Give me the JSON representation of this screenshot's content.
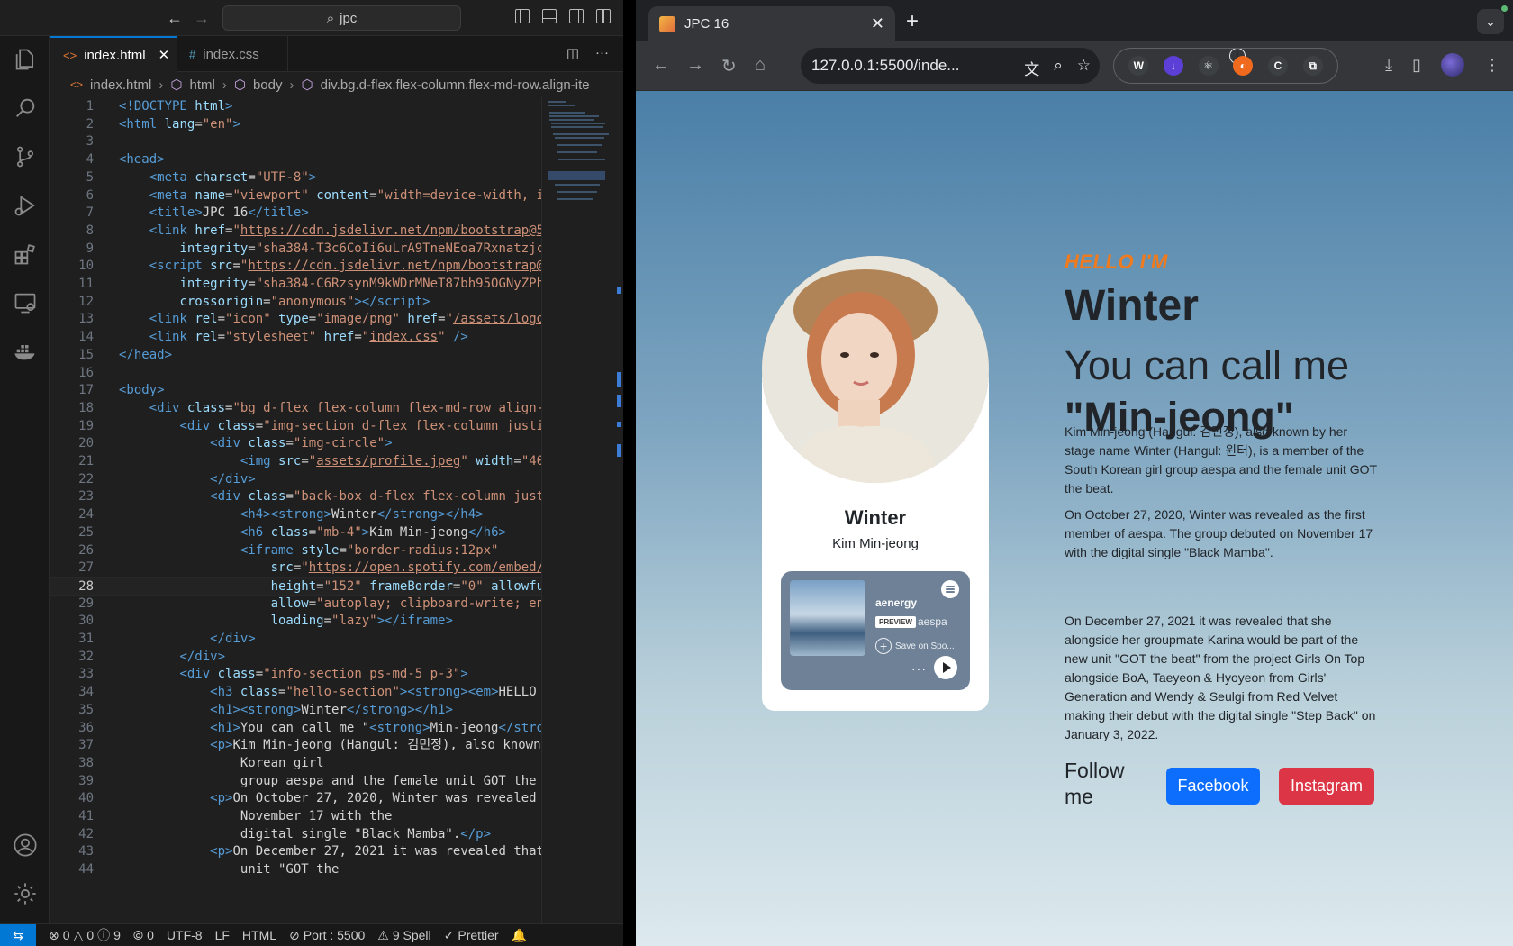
{
  "vscode": {
    "search_text": "jpc",
    "tabs": [
      {
        "icon": "<>",
        "label": "index.html"
      },
      {
        "icon": "#",
        "label": "index.css"
      }
    ],
    "breadcrumb": [
      "index.html",
      "html",
      "body",
      "div.bg.d-flex.flex-column.flex-md-row.align-ite"
    ],
    "lines": [
      {
        "n": "1",
        "html": "<span class='tg'>&lt;!DOCTYPE</span> <span class='at'>html</span><span class='tg'>&gt;</span>"
      },
      {
        "n": "2",
        "html": "<span class='tg'>&lt;html</span> <span class='at'>lang</span>=<span class='st'>\"en\"</span><span class='tg'>&gt;</span>"
      },
      {
        "n": "3",
        "html": ""
      },
      {
        "n": "4",
        "html": "<span class='tg'>&lt;head&gt;</span>"
      },
      {
        "n": "5",
        "html": "    <span class='tg'>&lt;meta</span> <span class='at'>charset</span>=<span class='st'>\"UTF-8\"</span><span class='tg'>&gt;</span>"
      },
      {
        "n": "6",
        "html": "    <span class='tg'>&lt;meta</span> <span class='at'>name</span>=<span class='st'>\"viewport\"</span> <span class='at'>content</span>=<span class='st'>\"width=device-width, i</span>"
      },
      {
        "n": "7",
        "html": "    <span class='tg'>&lt;title&gt;</span><span class='tx'>JPC 16</span><span class='tg'>&lt;/title&gt;</span>"
      },
      {
        "n": "8",
        "html": "    <span class='tg'>&lt;link</span> <span class='at'>href</span>=<span class='st'>\"<span class='ul'>https://cdn.jsdelivr.net/npm/bootstrap@5</span></span>"
      },
      {
        "n": "9",
        "html": "        <span class='at'>integrity</span>=<span class='st'>\"sha384-T3c6CoIi6uLrA9TneNEoa7Rxnatzjc</span>"
      },
      {
        "n": "10",
        "html": "    <span class='tg'>&lt;script</span> <span class='at'>src</span>=<span class='st'>\"<span class='ul'>https://cdn.jsdelivr.net/npm/bootstrap@</span></span>"
      },
      {
        "n": "11",
        "html": "        <span class='at'>integrity</span>=<span class='st'>\"sha384-C6RzsynM9kWDrMNeT87bh95OGNyZPh</span>"
      },
      {
        "n": "12",
        "html": "        <span class='at'>crossorigin</span>=<span class='st'>\"anonymous\"</span><span class='tg'>&gt;&lt;/script&gt;</span>"
      },
      {
        "n": "13",
        "html": "    <span class='tg'>&lt;link</span> <span class='at'>rel</span>=<span class='st'>\"icon\"</span> <span class='at'>type</span>=<span class='st'>\"image/png\"</span> <span class='at'>href</span>=<span class='st'>\"<span class='ul'>/assets/logo</span></span>"
      },
      {
        "n": "14",
        "html": "    <span class='tg'>&lt;link</span> <span class='at'>rel</span>=<span class='st'>\"stylesheet\"</span> <span class='at'>href</span>=<span class='st'>\"<span class='ul'>index.css</span>\"</span> <span class='tg'>/&gt;</span>"
      },
      {
        "n": "15",
        "html": "<span class='tg'>&lt;/head&gt;</span>"
      },
      {
        "n": "16",
        "html": ""
      },
      {
        "n": "17",
        "html": "<span class='tg'>&lt;body&gt;</span>"
      },
      {
        "n": "18",
        "html": "    <span class='tg'>&lt;div</span> <span class='at'>class</span>=<span class='st'>\"bg d-flex flex-column flex-md-row align-</span>"
      },
      {
        "n": "19",
        "html": "        <span class='tg'>&lt;div</span> <span class='at'>class</span>=<span class='st'>\"img-section d-flex flex-column justi</span>"
      },
      {
        "n": "20",
        "html": "            <span class='tg'>&lt;div</span> <span class='at'>class</span>=<span class='st'>\"img-circle\"</span><span class='tg'>&gt;</span>"
      },
      {
        "n": "21",
        "html": "                <span class='tg'>&lt;img</span> <span class='at'>src</span>=<span class='st'>\"<span class='ul'>assets/profile.jpeg</span>\"</span> <span class='at'>width</span>=<span class='st'>\"40</span>"
      },
      {
        "n": "22",
        "html": "            <span class='tg'>&lt;/div&gt;</span>"
      },
      {
        "n": "23",
        "html": "            <span class='tg'>&lt;div</span> <span class='at'>class</span>=<span class='st'>\"back-box d-flex flex-column just</span>"
      },
      {
        "n": "24",
        "html": "                <span class='tg'>&lt;h4&gt;&lt;strong&gt;</span><span class='tx'>Winter</span><span class='tg'>&lt;/strong&gt;&lt;/h4&gt;</span>"
      },
      {
        "n": "25",
        "html": "                <span class='tg'>&lt;h6</span> <span class='at'>class</span>=<span class='st'>\"mb-4\"</span><span class='tg'>&gt;</span><span class='tx'>Kim Min-jeong</span><span class='tg'>&lt;/h6&gt;</span>"
      },
      {
        "n": "26",
        "html": "                <span class='tg'>&lt;iframe</span> <span class='at'>style</span>=<span class='st'>\"border-radius:12px\"</span>"
      },
      {
        "n": "27",
        "html": "                    <span class='at'>src</span>=<span class='st'>\"<span class='ul'>https://open.spotify.com/embed/</span></span>"
      },
      {
        "n": "28",
        "html": "                    <span class='at'>height</span>=<span class='st'>\"152\"</span> <span class='at'>frameBorder</span>=<span class='st'>\"0\"</span> <span class='at'>allowfu</span>"
      },
      {
        "n": "29",
        "html": "                    <span class='at'>allow</span>=<span class='st'>\"autoplay; clipboard-write; en</span>"
      },
      {
        "n": "30",
        "html": "                    <span class='at'>loading</span>=<span class='st'>\"lazy\"</span><span class='tg'>&gt;&lt;/iframe&gt;</span>"
      },
      {
        "n": "31",
        "html": "            <span class='tg'>&lt;/div&gt;</span>"
      },
      {
        "n": "32",
        "html": "        <span class='tg'>&lt;/div&gt;</span>"
      },
      {
        "n": "33",
        "html": "        <span class='tg'>&lt;div</span> <span class='at'>class</span>=<span class='st'>\"info-section ps-md-5 p-3\"</span><span class='tg'>&gt;</span>"
      },
      {
        "n": "34",
        "html": "            <span class='tg'>&lt;h3</span> <span class='at'>class</span>=<span class='st'>\"hello-section\"</span><span class='tg'>&gt;&lt;strong&gt;&lt;em&gt;</span><span class='tx'>HELLO</span>"
      },
      {
        "n": "35",
        "html": "            <span class='tg'>&lt;h1&gt;&lt;strong&gt;</span><span class='tx'>Winter</span><span class='tg'>&lt;/strong&gt;&lt;/h1&gt;</span>"
      },
      {
        "n": "36",
        "html": "            <span class='tg'>&lt;h1&gt;</span><span class='tx'>You can call me \"</span><span class='tg'>&lt;strong&gt;</span><span class='tx'>Min-jeong</span><span class='tg'>&lt;/stro</span>"
      },
      {
        "n": "37",
        "html": "            <span class='tg'>&lt;p&gt;</span><span class='tx'>Kim Min-jeong (Hangul: 김민정), also known</span>"
      },
      {
        "n": "38",
        "html": "                <span class='tx'>Korean girl</span>"
      },
      {
        "n": "39",
        "html": "                <span class='tx'>group aespa and the female unit GOT the</span>"
      },
      {
        "n": "40",
        "html": "            <span class='tg'>&lt;p&gt;</span><span class='tx'>On October 27, 2020, Winter was revealed</span>"
      },
      {
        "n": "41",
        "html": "                <span class='tx'>November 17 with the</span>"
      },
      {
        "n": "42",
        "html": "                <span class='tx'>digital single \"Black Mamba\".</span><span class='tg'>&lt;/p&gt;</span>"
      },
      {
        "n": "43",
        "html": "            <span class='tg'>&lt;p&gt;</span><span class='tx'>On December 27, 2021 it was revealed that</span>"
      },
      {
        "n": "44",
        "html": "                <span class='tx'>unit \"GOT the</span>"
      }
    ],
    "status": {
      "errors": "0",
      "warnings": "0",
      "info": "9",
      "ports": "0",
      "encoding": "UTF-8",
      "eol": "LF",
      "language": "HTML",
      "port": "Port : 5500",
      "spell": "9 Spell",
      "formatter": "Prettier"
    }
  },
  "browser": {
    "tab_title": "JPC 16",
    "url": "127.0.0.1:5500/inde...",
    "page": {
      "hello": "HELLO I'M",
      "name_title": "Winter",
      "call_line1": "You can call me",
      "call_line2": "\"Min-jeong\"",
      "paragraphs": [
        "Kim Min-jeong (Hangul: 김민정), also known by her stage name Winter (Hangul: 윈터), is a member of the South Korean girl group aespa and the female unit GOT the beat.",
        "On October 27, 2020, Winter was revealed as the first member of aespa. The group debuted on November 17 with the digital single \"Black Mamba\".",
        "On December 27, 2021 it was revealed that she alongside her groupmate Karina would be part of the new unit \"GOT the beat\" from the project Girls On Top alongside BoA, Taeyeon & Hyoyeon from Girls' Generation and Wendy & Seulgi from Red Velvet making their debut with the digital single \"Step Back\" on January 3, 2022."
      ],
      "follow_label": "Follow me",
      "facebook_label": "Facebook",
      "instagram_label": "Instagram",
      "card_name": "Winter",
      "card_sub": "Kim Min-jeong",
      "spotify": {
        "track": "aenergy",
        "preview": "PREVIEW",
        "artist": "aespa",
        "save": "Save on Spo..."
      }
    },
    "colors": {
      "hello_accent": "#f07a1e",
      "facebook": "#0d6efd",
      "instagram": "#dc3545"
    }
  }
}
